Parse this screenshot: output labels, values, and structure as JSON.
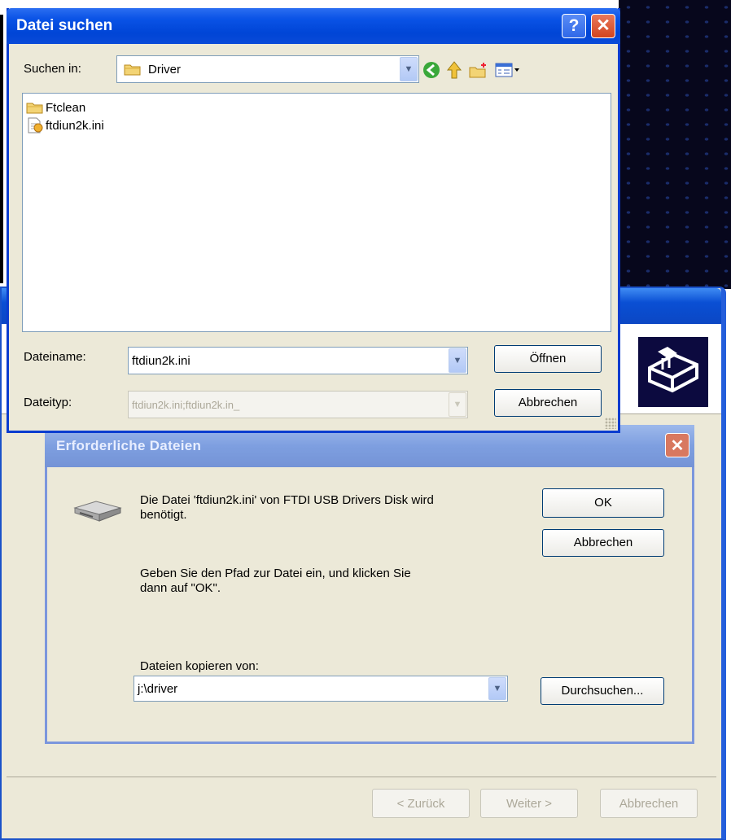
{
  "open_dialog": {
    "title": "Datei suchen",
    "help_glyph": "?",
    "close_glyph": "✕",
    "look_in_label": "Suchen in:",
    "look_in_value": "Driver",
    "files": [
      {
        "name": "Ftclean",
        "icon": "folder-icon"
      },
      {
        "name": "ftdiun2k.ini",
        "icon": "ini-file-icon"
      }
    ],
    "filename_label": "Dateiname:",
    "filename_value": "ftdiun2k.ini",
    "filetype_label": "Dateityp:",
    "filetype_value": "ftdiun2k.ini;ftdiun2k.in_",
    "open_button": "Öffnen",
    "cancel_button": "Abbrechen"
  },
  "required_dialog": {
    "title": "Erforderliche Dateien",
    "close_glyph": "✕",
    "message_line1": "Die Datei 'ftdiun2k.ini' von FTDI USB Drivers Disk wird",
    "message_line2": "benötigt.",
    "hint_line1": "Geben Sie den Pfad zur Datei ein, und klicken Sie",
    "hint_line2": "dann auf \"OK\".",
    "copy_from_label": "Dateien kopieren von:",
    "copy_from_value": "j:\\driver",
    "ok_button": "OK",
    "cancel_button": "Abbrechen",
    "browse_button": "Durchsuchen..."
  },
  "wizard": {
    "back_button": "< Zurück",
    "next_button": "Weiter >",
    "cancel_button": "Abbrechen"
  },
  "colors": {
    "xp_blue": "#0a53e6",
    "dialog_bg": "#ece9d8",
    "inactive_title": "#7e9fe0"
  }
}
